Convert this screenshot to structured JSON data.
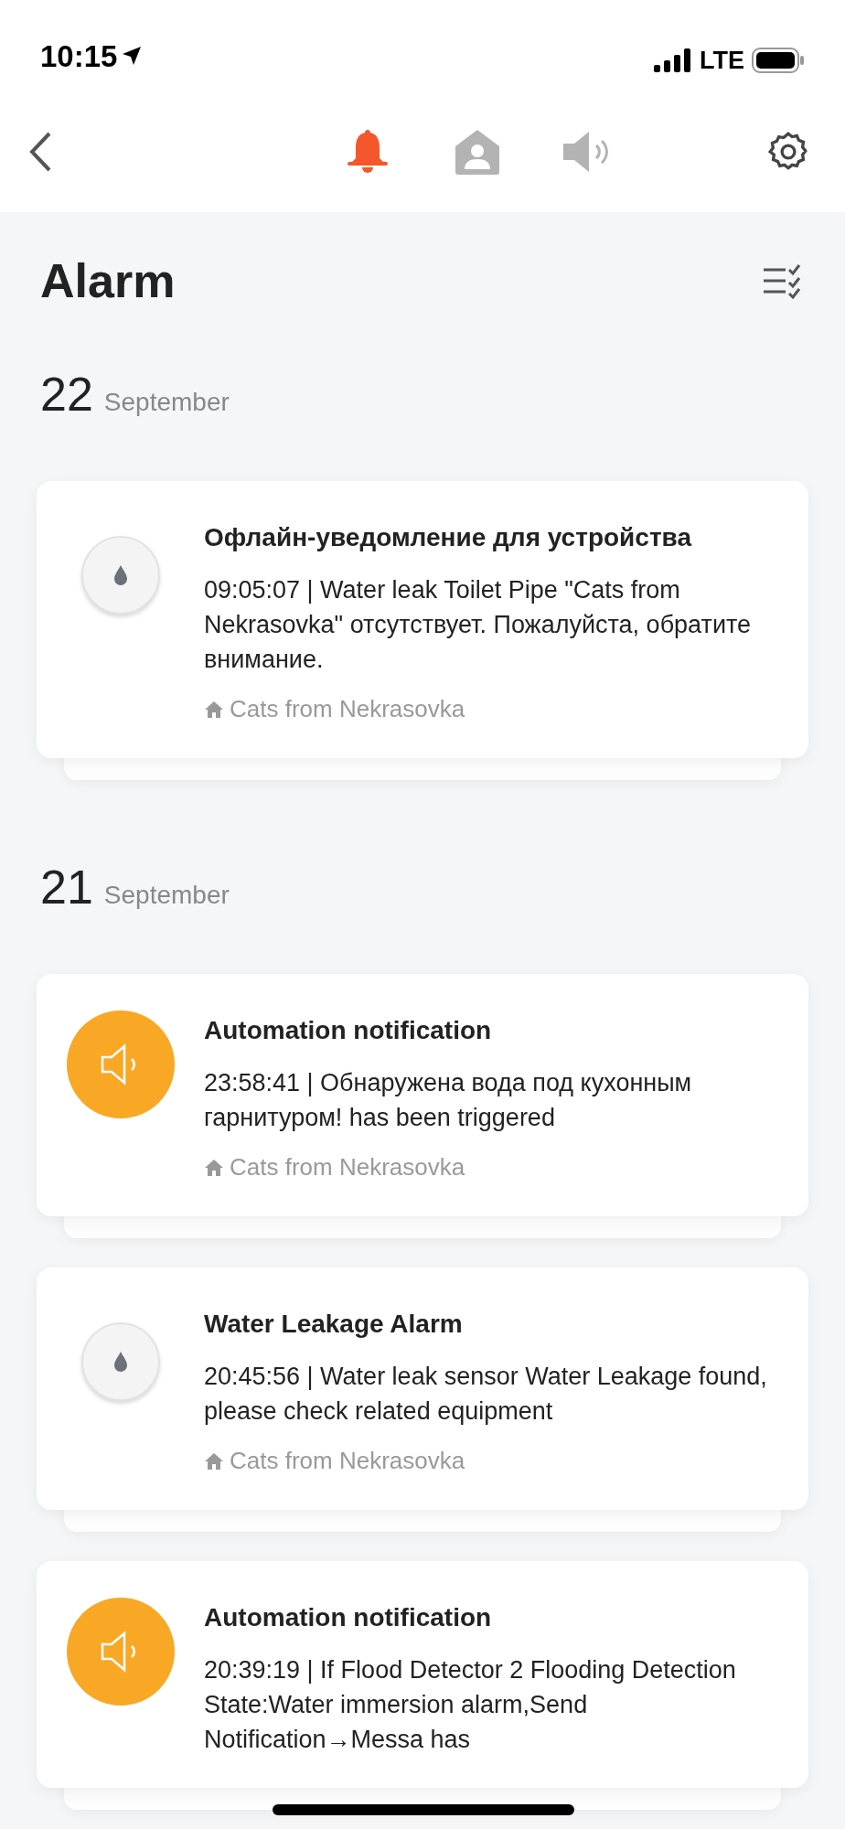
{
  "status_bar": {
    "time": "10:15",
    "network": "LTE"
  },
  "tabs": [
    {
      "kind": "bell",
      "selected": true
    },
    {
      "kind": "home",
      "selected": false
    },
    {
      "kind": "speaker",
      "selected": false
    }
  ],
  "title": "Alarm",
  "sections": [
    {
      "day": "22",
      "month": "September",
      "notifications": [
        {
          "kind": "device",
          "title": "Офлайн-уведомление для устройства",
          "body": "09:05:07 | Water leak Toilet Pipe \"Cats from Nekrasovka\" отсутствует. Пожалуйста, обратите внимание.",
          "home": "Cats from Nekrasovka"
        }
      ]
    },
    {
      "day": "21",
      "month": "September",
      "notifications": [
        {
          "kind": "automation",
          "title": "Automation notification",
          "body": "23:58:41 | Обнаружена вода под кухонным гарнитуром! has been triggered",
          "home": "Cats from Nekrasovka"
        },
        {
          "kind": "device",
          "title": "Water Leakage Alarm",
          "body": "20:45:56 | Water leak sensor Water Leakage found, please check related equipment",
          "home": "Cats from Nekrasovka"
        },
        {
          "kind": "automation",
          "title": "Automation notification",
          "body": "20:39:19 | If Flood Detector 2 Flooding Detection State:Water immersion alarm,Send Notification→Messa has"
        }
      ]
    }
  ]
}
